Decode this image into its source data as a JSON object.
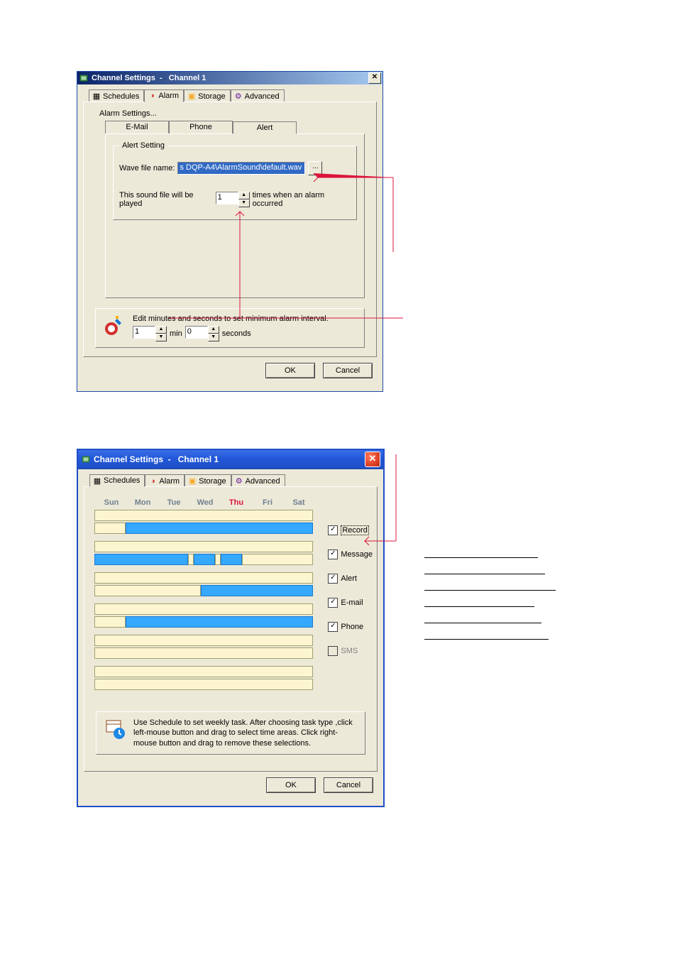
{
  "dlg1": {
    "title_a": "Channel Settings",
    "title_sep": "  -   ",
    "title_b": "Channel 1",
    "tabs": {
      "schedules": "Schedules",
      "alarm": "Alarm",
      "storage": "Storage",
      "advanced": "Advanced"
    },
    "subheader": "Alarm Settings...",
    "subtabs": {
      "email": "E-Mail",
      "phone": "Phone",
      "alert": "Alert"
    },
    "group_legend": "Alert Setting",
    "wave_label": "Wave file name:",
    "wave_value": "s DQP-A4\\AlarmSound\\default.wav",
    "browse": "...",
    "play_pre": "This sound file will be played",
    "play_count": "1",
    "play_post": "times when an alarm occurred",
    "interval_text": "Edit minutes and seconds to set minimum alarm interval.",
    "min_val": "1",
    "min_lbl": "min",
    "sec_val": "0",
    "sec_lbl": "seconds",
    "ok": "OK",
    "cancel": "Cancel"
  },
  "dlg2": {
    "title_a": "Channel Settings",
    "title_sep": "  -   ",
    "title_b": "Channel 1",
    "tabs": {
      "schedules": "Schedules",
      "alarm": "Alarm",
      "storage": "Storage",
      "advanced": "Advanced"
    },
    "days": {
      "sun": "Sun",
      "mon": "Mon",
      "tue": "Tue",
      "wed": "Wed",
      "thu": "Thu",
      "fri": "Fri",
      "sat": "Sat"
    },
    "opts": {
      "record": "Record",
      "message": "Message",
      "alert": "Alert",
      "email": "E-mail",
      "phone": "Phone",
      "sms": "SMS"
    },
    "help": "Use Schedule to set weekly task. After choosing task type ,click left-mouse  button and drag to select time areas. Click right-mouse button and drag to remove these selections.",
    "ok": "OK",
    "cancel": "Cancel"
  }
}
